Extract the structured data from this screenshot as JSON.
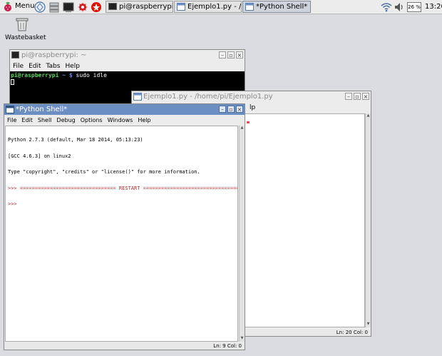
{
  "taskbar": {
    "menu_label": "Menu",
    "tasks": [
      {
        "label": "pi@raspberrypi: ~"
      },
      {
        "label": "Ejemplo1.py - /hom..."
      },
      {
        "label": "*Python Shell*"
      }
    ],
    "cpu_label": "26 %",
    "clock": "13:20"
  },
  "desktop": {
    "wastebasket_label": "Wastebasket"
  },
  "terminal": {
    "title": "pi@raspberrypi: ~",
    "menu": [
      "File",
      "Edit",
      "Tabs",
      "Help"
    ],
    "prompt_user": "pi@raspberrypi",
    "prompt_path": "~ $",
    "command": "sudo idle"
  },
  "editor": {
    "title": "Ejemplo1.py - /home/pi/Ejemplo1.py",
    "menu_fragment": "lp",
    "status": "Ln: 20 Col: 0"
  },
  "shell": {
    "title": "*Python Shell*",
    "menu": [
      "File",
      "Edit",
      "Shell",
      "Debug",
      "Options",
      "Windows",
      "Help"
    ],
    "lines": [
      "Python 2.7.3 (default, Mar 18 2014, 05:13:23)",
      "[GCC 4.6.3] on linux2",
      "Type \"copyright\", \"credits\" or \"license()\" for more information.",
      ">>> ================================ RESTART ================================",
      ">>>"
    ],
    "status": "Ln: 9 Col: 0"
  },
  "colors": {
    "titlebar_active": "#6b8fc2",
    "prompt_green": "#5fd35f",
    "prompt_blue": "#5c8df0"
  }
}
